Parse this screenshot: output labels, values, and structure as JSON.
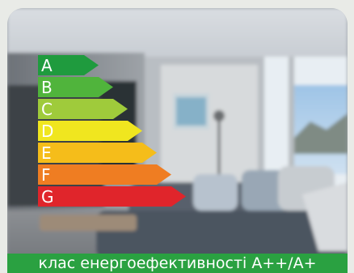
{
  "energy_classes": [
    {
      "letter": "A",
      "color": "#1f9b3e"
    },
    {
      "letter": "B",
      "color": "#50b43c"
    },
    {
      "letter": "C",
      "color": "#9fcb3b"
    },
    {
      "letter": "D",
      "color": "#f0e61f"
    },
    {
      "letter": "E",
      "color": "#f5bd1a"
    },
    {
      "letter": "F",
      "color": "#ef7d22"
    },
    {
      "letter": "G",
      "color": "#e0252b"
    }
  ],
  "caption": "клас енергоефективності А++/А+",
  "colors": {
    "caption_bg": "#2aa141",
    "page_bg": "#e9ebe7"
  }
}
